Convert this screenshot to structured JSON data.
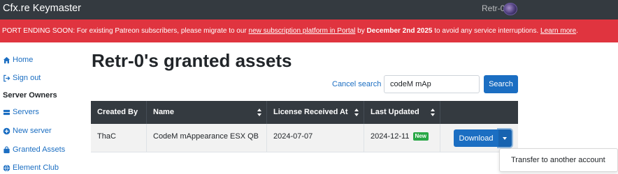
{
  "nav": {
    "brand": "Cfx.re Keymaster",
    "user": "Retr-0"
  },
  "alert": {
    "prefix": "PORT ENDING SOON:",
    "text1": " For existing Patreon subscribers, please migrate to our ",
    "link1": "new subscription platform in Portal",
    "text2": " by ",
    "date": "December 2nd 2025",
    "text3": " to avoid any service interruptions. ",
    "link2": "Learn more",
    "text4": "."
  },
  "sidebar": {
    "items": [
      {
        "label": "Home",
        "icon": "home-icon"
      },
      {
        "label": "Sign out",
        "icon": "sign-out-icon"
      }
    ],
    "heading": "Server Owners",
    "owner_items": [
      {
        "label": "Servers",
        "icon": "server-icon"
      },
      {
        "label": "New server",
        "icon": "plus-circle-icon"
      },
      {
        "label": "Granted Assets",
        "icon": "shopping-bag-icon"
      },
      {
        "label": "Element Club",
        "icon": "globe-icon"
      }
    ]
  },
  "main": {
    "title": "Retr-0's granted assets",
    "cancel_search": "Cancel search",
    "search_value": "codeM mAp",
    "search_button": "Search"
  },
  "table": {
    "headers": [
      "Created By",
      "Name",
      "License Received At",
      "Last Updated"
    ],
    "rows": [
      {
        "created_by": "ThaC",
        "name": "CodeM mAppearance ESX QB",
        "license_received": "2024-07-07",
        "last_updated": "2024-12-11",
        "badge": "New",
        "download": "Download"
      }
    ]
  },
  "dropdown": {
    "items": [
      "Transfer to another account"
    ]
  },
  "colors": {
    "nav_bg": "#343a40",
    "alert_bg": "#e0343f",
    "primary": "#1b6ec2",
    "badge_green": "#28a745"
  }
}
